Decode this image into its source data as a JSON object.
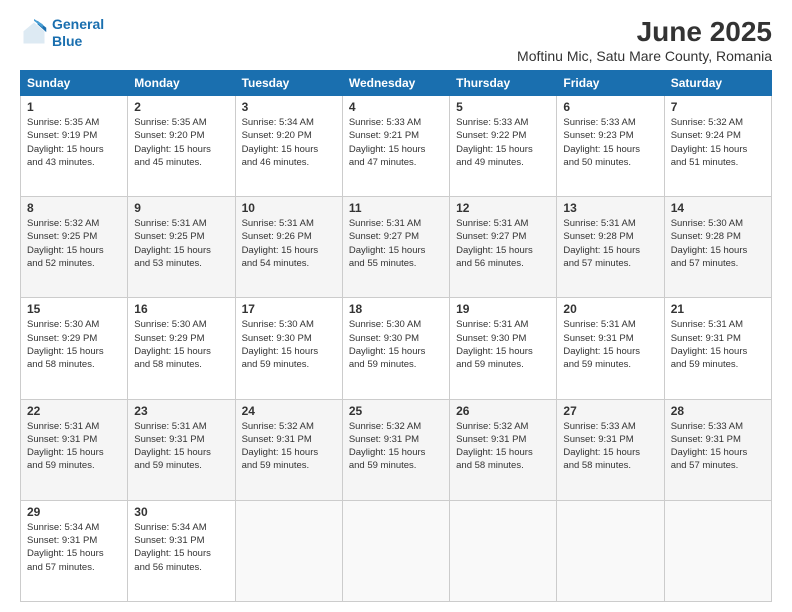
{
  "logo": {
    "line1": "General",
    "line2": "Blue"
  },
  "title": "June 2025",
  "subtitle": "Moftinu Mic, Satu Mare County, Romania",
  "days_header": [
    "Sunday",
    "Monday",
    "Tuesday",
    "Wednesday",
    "Thursday",
    "Friday",
    "Saturday"
  ],
  "weeks": [
    [
      {
        "num": "1",
        "rise": "5:35 AM",
        "set": "9:19 PM",
        "daylight": "15 hours and 43 minutes."
      },
      {
        "num": "2",
        "rise": "5:35 AM",
        "set": "9:20 PM",
        "daylight": "15 hours and 45 minutes."
      },
      {
        "num": "3",
        "rise": "5:34 AM",
        "set": "9:20 PM",
        "daylight": "15 hours and 46 minutes."
      },
      {
        "num": "4",
        "rise": "5:33 AM",
        "set": "9:21 PM",
        "daylight": "15 hours and 47 minutes."
      },
      {
        "num": "5",
        "rise": "5:33 AM",
        "set": "9:22 PM",
        "daylight": "15 hours and 49 minutes."
      },
      {
        "num": "6",
        "rise": "5:33 AM",
        "set": "9:23 PM",
        "daylight": "15 hours and 50 minutes."
      },
      {
        "num": "7",
        "rise": "5:32 AM",
        "set": "9:24 PM",
        "daylight": "15 hours and 51 minutes."
      }
    ],
    [
      {
        "num": "8",
        "rise": "5:32 AM",
        "set": "9:25 PM",
        "daylight": "15 hours and 52 minutes."
      },
      {
        "num": "9",
        "rise": "5:31 AM",
        "set": "9:25 PM",
        "daylight": "15 hours and 53 minutes."
      },
      {
        "num": "10",
        "rise": "5:31 AM",
        "set": "9:26 PM",
        "daylight": "15 hours and 54 minutes."
      },
      {
        "num": "11",
        "rise": "5:31 AM",
        "set": "9:27 PM",
        "daylight": "15 hours and 55 minutes."
      },
      {
        "num": "12",
        "rise": "5:31 AM",
        "set": "9:27 PM",
        "daylight": "15 hours and 56 minutes."
      },
      {
        "num": "13",
        "rise": "5:31 AM",
        "set": "9:28 PM",
        "daylight": "15 hours and 57 minutes."
      },
      {
        "num": "14",
        "rise": "5:30 AM",
        "set": "9:28 PM",
        "daylight": "15 hours and 57 minutes."
      }
    ],
    [
      {
        "num": "15",
        "rise": "5:30 AM",
        "set": "9:29 PM",
        "daylight": "15 hours and 58 minutes."
      },
      {
        "num": "16",
        "rise": "5:30 AM",
        "set": "9:29 PM",
        "daylight": "15 hours and 58 minutes."
      },
      {
        "num": "17",
        "rise": "5:30 AM",
        "set": "9:30 PM",
        "daylight": "15 hours and 59 minutes."
      },
      {
        "num": "18",
        "rise": "5:30 AM",
        "set": "9:30 PM",
        "daylight": "15 hours and 59 minutes."
      },
      {
        "num": "19",
        "rise": "5:31 AM",
        "set": "9:30 PM",
        "daylight": "15 hours and 59 minutes."
      },
      {
        "num": "20",
        "rise": "5:31 AM",
        "set": "9:31 PM",
        "daylight": "15 hours and 59 minutes."
      },
      {
        "num": "21",
        "rise": "5:31 AM",
        "set": "9:31 PM",
        "daylight": "15 hours and 59 minutes."
      }
    ],
    [
      {
        "num": "22",
        "rise": "5:31 AM",
        "set": "9:31 PM",
        "daylight": "15 hours and 59 minutes."
      },
      {
        "num": "23",
        "rise": "5:31 AM",
        "set": "9:31 PM",
        "daylight": "15 hours and 59 minutes."
      },
      {
        "num": "24",
        "rise": "5:32 AM",
        "set": "9:31 PM",
        "daylight": "15 hours and 59 minutes."
      },
      {
        "num": "25",
        "rise": "5:32 AM",
        "set": "9:31 PM",
        "daylight": "15 hours and 59 minutes."
      },
      {
        "num": "26",
        "rise": "5:32 AM",
        "set": "9:31 PM",
        "daylight": "15 hours and 58 minutes."
      },
      {
        "num": "27",
        "rise": "5:33 AM",
        "set": "9:31 PM",
        "daylight": "15 hours and 58 minutes."
      },
      {
        "num": "28",
        "rise": "5:33 AM",
        "set": "9:31 PM",
        "daylight": "15 hours and 57 minutes."
      }
    ],
    [
      {
        "num": "29",
        "rise": "5:34 AM",
        "set": "9:31 PM",
        "daylight": "15 hours and 57 minutes."
      },
      {
        "num": "30",
        "rise": "5:34 AM",
        "set": "9:31 PM",
        "daylight": "15 hours and 56 minutes."
      },
      null,
      null,
      null,
      null,
      null
    ]
  ]
}
